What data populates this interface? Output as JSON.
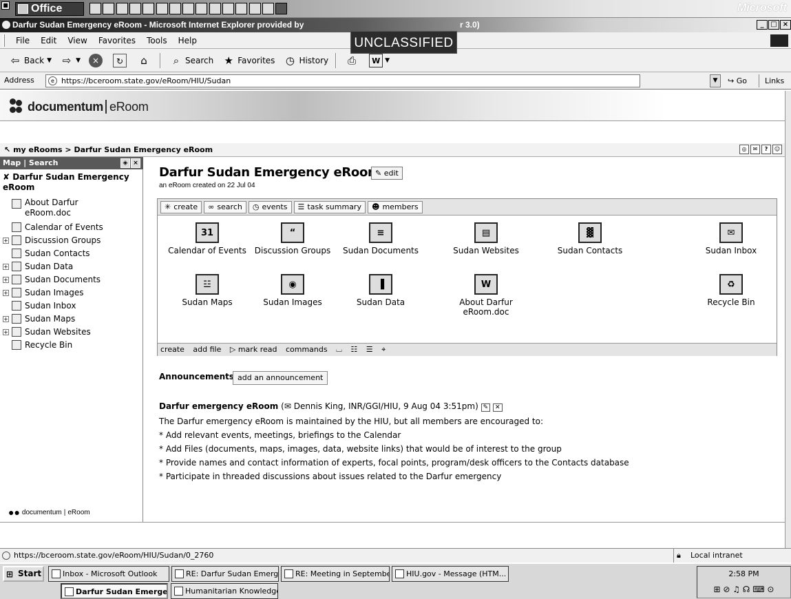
{
  "office_bar": {
    "label": "Office",
    "brand": "Microsoft",
    "button_icons": [
      "access-icon",
      "excel-icon",
      "outlook-icon",
      "calendar-icon",
      "binder-icon",
      "word-icon",
      "task-icon",
      "frontpage-icon",
      "contact-icon",
      "mail-icon",
      "journal-icon",
      "note-icon",
      "checklist-icon",
      "project-icon",
      "bar-icon"
    ]
  },
  "window": {
    "title": "Darfur Sudan Emergency eRoom - Microsoft Internet Explorer provided by",
    "title_suffix": "r 3.0)",
    "classification": "UNCLASSIFIED",
    "controls": [
      "_",
      "□",
      "×"
    ]
  },
  "menu": [
    "File",
    "Edit",
    "View",
    "Favorites",
    "Tools",
    "Help"
  ],
  "toolbar": {
    "back": "Back",
    "search": "Search",
    "favorites": "Favorites",
    "history": "History"
  },
  "address": {
    "label": "Address",
    "url": "https://bceroom.state.gov/eRoom/HIU/Sudan",
    "go": "Go",
    "links": "Links"
  },
  "brand": {
    "name": "documentum",
    "product": "eRoom"
  },
  "breadcrumb": {
    "text": "my eRooms > Darfur Sudan Emergency eRoom"
  },
  "sidebar": {
    "tabs": "Map | Search",
    "root": "Darfur Sudan Emergency eRoom",
    "items": [
      {
        "label": "About Darfur eRoom.doc",
        "expandable": false,
        "icon": "word-doc-icon"
      },
      {
        "label": "Calendar of Events",
        "expandable": false,
        "icon": "calendar-icon"
      },
      {
        "label": "Discussion Groups",
        "expandable": true,
        "icon": "discussion-icon"
      },
      {
        "label": "Sudan Contacts",
        "expandable": false,
        "icon": "contacts-icon"
      },
      {
        "label": "Sudan Data",
        "expandable": true,
        "icon": "data-icon"
      },
      {
        "label": "Sudan Documents",
        "expandable": true,
        "icon": "documents-icon"
      },
      {
        "label": "Sudan Images",
        "expandable": true,
        "icon": "images-icon"
      },
      {
        "label": "Sudan Inbox",
        "expandable": false,
        "icon": "inbox-icon"
      },
      {
        "label": "Sudan Maps",
        "expandable": true,
        "icon": "maps-icon"
      },
      {
        "label": "Sudan Websites",
        "expandable": true,
        "icon": "websites-icon"
      },
      {
        "label": "Recycle Bin",
        "expandable": false,
        "icon": "recycle-icon"
      }
    ],
    "footer_brand": "documentum",
    "footer_product": "eRoom"
  },
  "main": {
    "title": "Darfur Sudan Emergency eRoom",
    "edit_label": "edit",
    "subtitle": "an eRoom created on 22 Jul 04",
    "panel_tabs": [
      "create",
      "search",
      "events",
      "task summary",
      "members"
    ],
    "grid": [
      {
        "label": "Calendar of Events",
        "glyph": "31"
      },
      {
        "label": "Discussion Groups",
        "glyph": "“"
      },
      {
        "label": "Sudan Documents",
        "glyph": "≡"
      },
      {
        "label": "Sudan Websites",
        "glyph": "▤"
      },
      {
        "label": "Sudan Contacts",
        "glyph": "▓"
      },
      {
        "label": "Sudan Inbox",
        "glyph": "✉"
      },
      {
        "label": "Sudan Maps",
        "glyph": "☳"
      },
      {
        "label": "Sudan Images",
        "glyph": "◉"
      },
      {
        "label": "Sudan Data",
        "glyph": "▐"
      },
      {
        "label": "About Darfur eRoom.doc",
        "glyph": "W"
      },
      {
        "label": "Recycle Bin",
        "glyph": "♻"
      }
    ],
    "panel_bottom": [
      "create",
      "add file",
      "▷ mark read",
      "commands"
    ],
    "announcements_label": "Announcements",
    "add_announcement_label": "add an announcement",
    "announcement": {
      "title": "Darfur emergency eRoom",
      "meta": "Dennis King, INR/GGI/HIU, 9 Aug 04  3:51pm)",
      "lines": [
        "The Darfur emergency eRoom is maintained by the HIU, but all members are encouraged to:",
        "* Add relevant events, meetings, briefings to the Calendar",
        "* Add Files (documents, maps, images, data, website links) that would be of interest to the group",
        "* Provide names and contact information of experts, focal points, program/desk officers to the Contacts database",
        "* Participate in threaded discussions about issues related to the Darfur emergency"
      ]
    }
  },
  "status": {
    "url": "https://bceroom.state.gov/eRoom/HIU/Sudan/0_2760",
    "zone": "Local intranet"
  },
  "taskbar": {
    "start": "Start",
    "row1": [
      "Inbox - Microsoft Outlook",
      "RE: Darfur Sudan Emerge...",
      "RE: Meeting in September...",
      "HIU.gov - Message (HTM..."
    ],
    "row2": [
      "Darfur Sudan Emergen...",
      "Humanitarian Knowledge ..."
    ],
    "clock": "2:58 PM"
  }
}
